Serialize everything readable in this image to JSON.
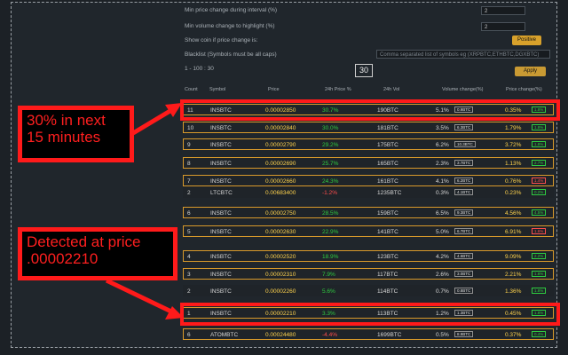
{
  "settings": {
    "row1_label": "Min price change during interval (%)",
    "row1_value": "2",
    "row2_label": "Min volume change to highlight (%)",
    "row2_value": "2",
    "row3_label": "Show coin if price change is:",
    "row3_value": "Positive",
    "row4_label": "Blacklist (Symbols must be all caps)",
    "row4_value": "Comma separated list of symbols eg (XRPBTC,ETHBTC,DGXBTC)",
    "range_text": "1 - 100 : 30",
    "interval_box": "30",
    "apply_label": "Apply"
  },
  "table": {
    "headers": [
      "Count",
      "Symbol",
      "Price",
      "24h Price %",
      "24h Vol",
      "Volume change(%)",
      "Price change(%)"
    ],
    "rows": [
      {
        "count": "11",
        "symbol": "INSBTC",
        "price": "0.00002850",
        "p24": "30.7%",
        "vol": "190BTC",
        "vchg": "5.1%",
        "vbtn": "0.9BTC",
        "pchg": "0.35%",
        "pbtn": "1.8%"
      },
      {
        "count": "10",
        "symbol": "INSBTC",
        "price": "0.00002840",
        "p24": "30.0%",
        "vol": "181BTC",
        "vchg": "3.5%",
        "vbtn": "6.3BTC",
        "pchg": "1.79%",
        "pbtn": "1.8%"
      },
      {
        "count": "9",
        "symbol": "INSBTC",
        "price": "0.00002790",
        "p24": "29.2%",
        "vol": "175BTC",
        "vchg": "6.2%",
        "vbtn": "10.3BTC",
        "pchg": "3.72%",
        "pbtn": "1.8%"
      },
      {
        "count": "8",
        "symbol": "INSBTC",
        "price": "0.00002690",
        "p24": "25.7%",
        "vol": "165BTC",
        "vchg": "2.3%",
        "vbtn": "3.7BTC",
        "pchg": "1.13%",
        "pbtn": "2.7%"
      },
      {
        "count": "7",
        "symbol": "INSBTC",
        "price": "0.00002660",
        "p24": "24.3%",
        "vol": "161BTC",
        "vchg": "4.1%",
        "vbtn": "6.2BTC",
        "pchg": "0.76%",
        "pbtn": "1.4%"
      },
      {
        "count": "2",
        "symbol": "LTCBTC",
        "price": "0.00683400",
        "p24": "-1.2%",
        "vol": "1235BTC",
        "vchg": "0.3%",
        "vbtn": "4.1BTC",
        "pchg": "0.23%",
        "pbtn": "0.2%"
      },
      {
        "count": "6",
        "symbol": "INSBTC",
        "price": "0.00002750",
        "p24": "28.5%",
        "vol": "159BTC",
        "vchg": "6.5%",
        "vbtn": "9.3BTC",
        "pchg": "4.56%",
        "pbtn": "4.5%"
      },
      {
        "count": "5",
        "symbol": "INSBTC",
        "price": "0.00002630",
        "p24": "22.9%",
        "vol": "141BTC",
        "vchg": "5.0%",
        "vbtn": "6.7BTC",
        "pchg": "6.91%",
        "pbtn": "1.6%"
      },
      {
        "count": "4",
        "symbol": "INSBTC",
        "price": "0.00002520",
        "p24": "18.9%",
        "vol": "123BTC",
        "vchg": "4.2%",
        "vbtn": "4.6BTC",
        "pchg": "9.09%",
        "pbtn": "2.2%"
      },
      {
        "count": "3",
        "symbol": "INSBTC",
        "price": "0.00002310",
        "p24": "7.9%",
        "vol": "117BTC",
        "vchg": "2.6%",
        "vbtn": "3.0BTC",
        "pchg": "2.21%",
        "pbtn": "1.8%"
      },
      {
        "count": "2",
        "symbol": "INSBTC",
        "price": "0.00002260",
        "p24": "5.6%",
        "vol": "114BTC",
        "vchg": "0.7%",
        "vbtn": "0.8BTC",
        "pchg": "1.36%",
        "pbtn": "1.8%"
      },
      {
        "count": "1",
        "symbol": "INSBTC",
        "price": "0.00002210",
        "p24": "3.3%",
        "vol": "113BTC",
        "vchg": "1.2%",
        "vbtn": "1.3BTC",
        "pchg": "0.45%",
        "pbtn": "1.8%"
      },
      {
        "count": "6",
        "symbol": "ATOMBTC",
        "price": "0.00024480",
        "p24": "-4.4%",
        "vol": "1699BTC",
        "vchg": "0.5%",
        "vbtn": "8.9BTC",
        "pchg": "0.37%",
        "pbtn": "0.4%"
      }
    ]
  },
  "annotations": {
    "top_callout": "30% in next 15 minutes",
    "bottom_callout": "Detected at price .00002210"
  }
}
